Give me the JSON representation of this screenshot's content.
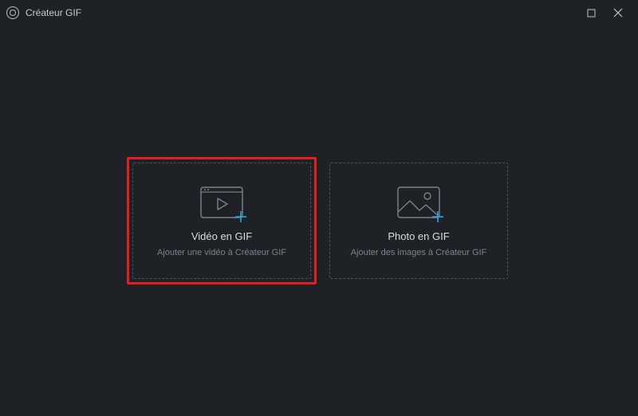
{
  "titlebar": {
    "title": "Créateur GIF"
  },
  "cards": {
    "video": {
      "title": "Vidéo en GIF",
      "subtitle": "Ajouter une vidéo à Créateur GIF",
      "highlighted": true
    },
    "photo": {
      "title": "Photo en GIF",
      "subtitle": "Ajouter des images à Créateur GIF",
      "highlighted": false
    }
  },
  "colors": {
    "background": "#1e2126",
    "cardBorder": "#4c5057",
    "highlight": "#e11f1f",
    "accent": "#2aa7e0",
    "textPrimary": "#d9dce0",
    "textSecondary": "#7d828a"
  }
}
